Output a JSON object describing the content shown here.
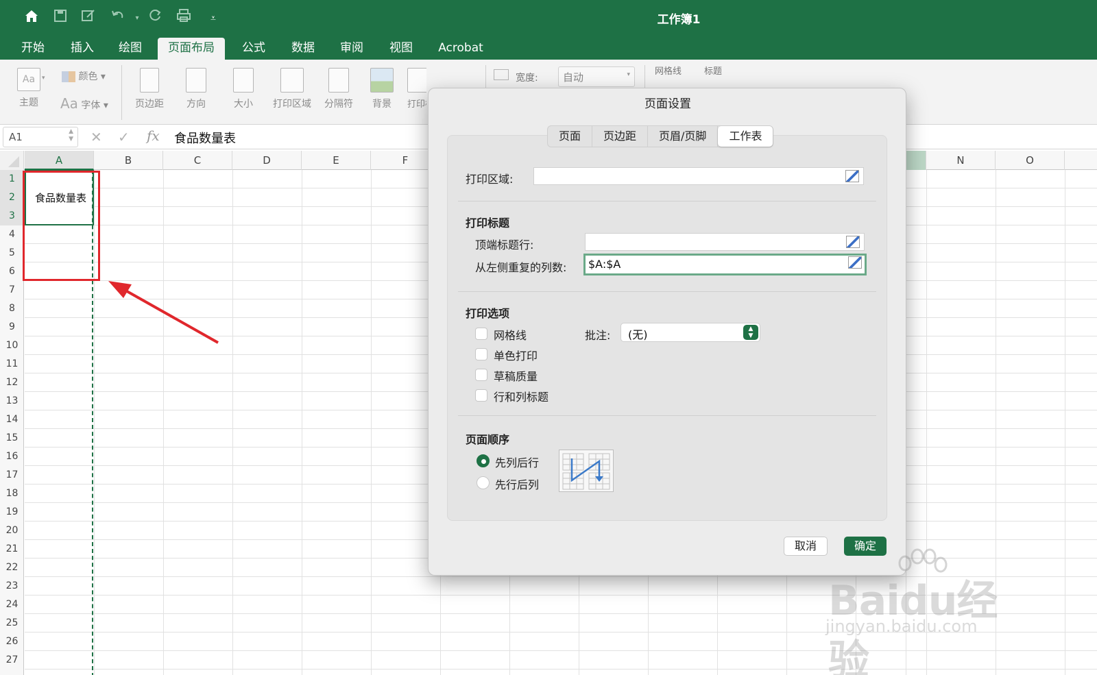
{
  "titlebar": {
    "title": "工作簿1",
    "background_color": "#1e7145",
    "quick_access": [
      "home-icon",
      "save-icon",
      "edit-icon",
      "undo-icon",
      "redo-icon",
      "print-icon",
      "customize-icon"
    ]
  },
  "ribbon": {
    "tabs": [
      "开始",
      "插入",
      "绘图",
      "页面布局",
      "公式",
      "数据",
      "审阅",
      "视图",
      "Acrobat"
    ],
    "active_tab": "页面布局",
    "theme_group": {
      "theme": "主题",
      "colors": "颜色",
      "fonts": "字体"
    },
    "buttons": [
      "页边距",
      "方向",
      "大小",
      "打印区域",
      "分隔符",
      "背景",
      "打印标题"
    ],
    "width_label": "宽度:",
    "width_value": "自动",
    "gridlines_label": "网格线",
    "headings_label": "标题"
  },
  "formula_bar": {
    "name_box": "A1",
    "fx": "fx",
    "content": "食品数量表"
  },
  "sheet": {
    "columns": [
      "A",
      "B",
      "C",
      "D",
      "E",
      "F",
      "N",
      "O"
    ],
    "rows": [
      "1",
      "2",
      "3",
      "4",
      "5",
      "6",
      "7",
      "8",
      "9",
      "10",
      "11",
      "12",
      "13",
      "14",
      "15",
      "16",
      "17",
      "18",
      "19",
      "20",
      "21",
      "22",
      "23",
      "24",
      "25",
      "26",
      "27"
    ],
    "merged_cell_text": "食品数量表"
  },
  "dialog": {
    "title": "页面设置",
    "tabs": [
      "页面",
      "页边距",
      "页眉/页脚",
      "工作表"
    ],
    "active_tab": "工作表",
    "print_area_label": "打印区域:",
    "print_area_value": "",
    "print_titles_heading": "打印标题",
    "rows_to_repeat_label": "顶端标题行:",
    "rows_to_repeat_value": "",
    "cols_to_repeat_label": "从左侧重复的列数:",
    "cols_to_repeat_value": "$A:$A",
    "print_options_heading": "打印选项",
    "options": [
      {
        "label": "网格线",
        "checked": false
      },
      {
        "label": "单色打印",
        "checked": false
      },
      {
        "label": "草稿质量",
        "checked": false
      },
      {
        "label": "行和列标题",
        "checked": false
      }
    ],
    "comments_label": "批注:",
    "comments_value": "(无)",
    "page_order_heading": "页面顺序",
    "page_order_options": [
      {
        "label": "先列后行",
        "selected": true
      },
      {
        "label": "先行后列",
        "selected": false
      }
    ],
    "cancel_label": "取消",
    "ok_label": "确定"
  },
  "annotation": {
    "highlight_color": "#e0272c"
  },
  "watermark": {
    "text": "Baidu经验",
    "url": "jingyan.baidu.com"
  }
}
